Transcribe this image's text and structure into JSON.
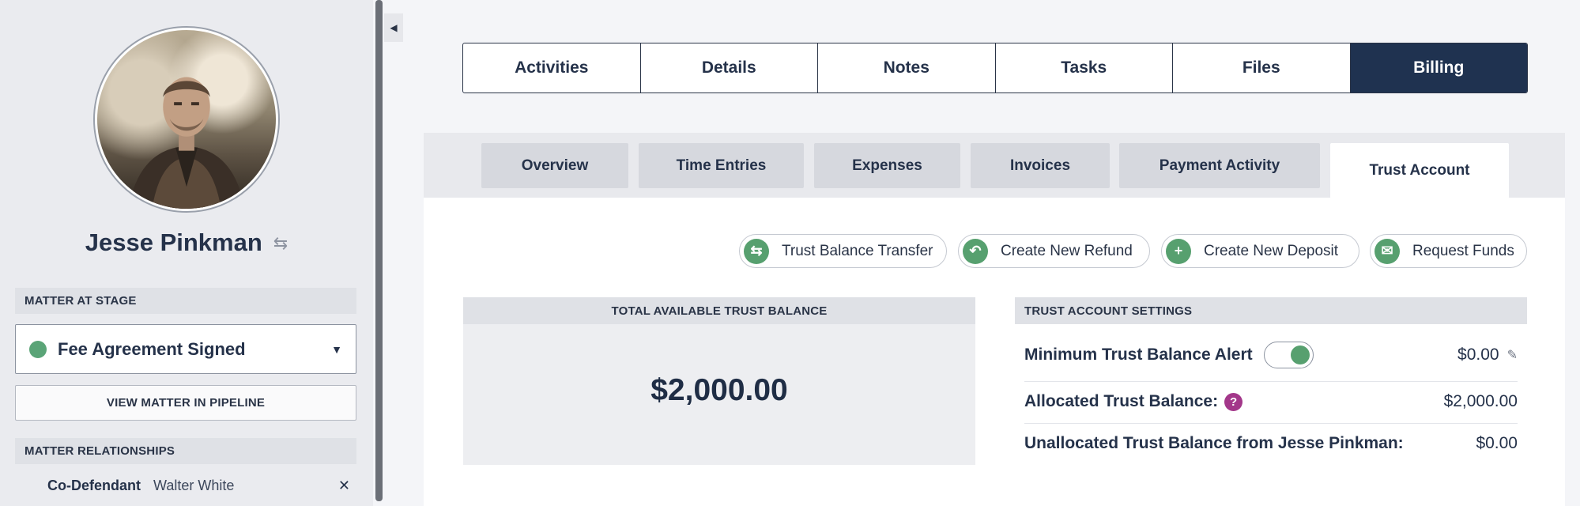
{
  "sidebar": {
    "person_name": "Jesse Pinkman",
    "stage_header": "MATTER AT STAGE",
    "stage_value": "Fee Agreement Signed",
    "stage_color": "#5aa477",
    "pipeline_button": "VIEW MATTER IN PIPELINE",
    "relationships_header": "MATTER RELATIONSHIPS",
    "relationships": [
      {
        "role": "Co-Defendant",
        "name": "Walter White"
      }
    ]
  },
  "tabs": [
    "Activities",
    "Details",
    "Notes",
    "Tasks",
    "Files",
    "Billing"
  ],
  "active_tab": "Billing",
  "subtabs": [
    "Overview",
    "Time Entries",
    "Expenses",
    "Invoices",
    "Payment Activity",
    "Trust Account"
  ],
  "active_subtab": "Trust Account",
  "actions": [
    {
      "label": "Trust Balance Transfer",
      "icon": "transfer-icon"
    },
    {
      "label": "Create New Refund",
      "icon": "undo-icon"
    },
    {
      "label": "Create New Deposit",
      "icon": "plus-icon"
    },
    {
      "label": "Request Funds",
      "icon": "envelope-icon"
    }
  ],
  "balance": {
    "header": "TOTAL AVAILABLE TRUST BALANCE",
    "amount": "$2,000.00"
  },
  "settings": {
    "header": "TRUST ACCOUNT SETTINGS",
    "min_alert_label": "Minimum Trust Balance Alert",
    "min_alert_enabled": true,
    "min_alert_value": "$0.00",
    "allocated_label": "Allocated Trust Balance:",
    "allocated_value": "$2,000.00",
    "unallocated_label": "Unallocated Trust Balance from Jesse Pinkman:",
    "unallocated_value": "$0.00"
  },
  "colors": {
    "navy": "#1f3250",
    "green": "#57a06f",
    "help": "#a3378a"
  }
}
